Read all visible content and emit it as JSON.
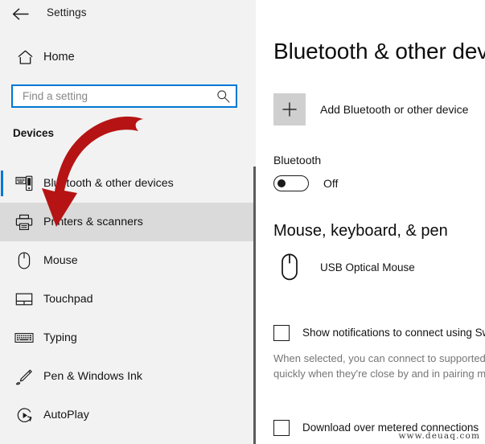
{
  "window": {
    "title": "Settings",
    "back_icon": "back-arrow-icon"
  },
  "sidebar": {
    "home": {
      "label": "Home",
      "icon": "home-icon"
    },
    "search": {
      "value": "",
      "placeholder": "Find a setting",
      "icon": "search-icon"
    },
    "section_heading": "Devices",
    "items": [
      {
        "label": "Bluetooth & other devices",
        "icon": "bluetooth-devices-icon",
        "state": "active-page"
      },
      {
        "label": "Printers & scanners",
        "icon": "printer-icon",
        "state": "hovered"
      },
      {
        "label": "Mouse",
        "icon": "mouse-icon",
        "state": "normal"
      },
      {
        "label": "Touchpad",
        "icon": "touchpad-icon",
        "state": "normal"
      },
      {
        "label": "Typing",
        "icon": "keyboard-icon",
        "state": "normal"
      },
      {
        "label": "Pen & Windows Ink",
        "icon": "pen-icon",
        "state": "normal"
      },
      {
        "label": "AutoPlay",
        "icon": "autoplay-icon",
        "state": "normal"
      }
    ]
  },
  "main": {
    "page_title": "Bluetooth & other devices",
    "add_device": {
      "label": "Add Bluetooth or other device",
      "icon": "plus-icon"
    },
    "bluetooth": {
      "heading": "Bluetooth",
      "toggle_state": "Off"
    },
    "mouse_keyboard_pen": {
      "heading": "Mouse, keyboard, & pen",
      "devices": [
        {
          "name": "USB Optical Mouse",
          "icon": "mouse-device-icon"
        }
      ]
    },
    "checkboxes": [
      {
        "label": "Show notifications to connect using Swift Pair",
        "checked": false,
        "description_lines": [
          "When selected, you can connect to supported Bluetooth devices",
          "quickly when they're close by and in pairing mode."
        ]
      },
      {
        "label": "Download over metered connections",
        "checked": false
      }
    ]
  },
  "annotation": {
    "arrow_color": "#b61414",
    "arrow_target": "Printers & scanners"
  },
  "watermark": "www.deuaq.com",
  "colors": {
    "accent": "#0078d4",
    "sidebar_bg": "#f2f2f2",
    "hover_bg": "#dadada",
    "annotation_red": "#b61414"
  }
}
